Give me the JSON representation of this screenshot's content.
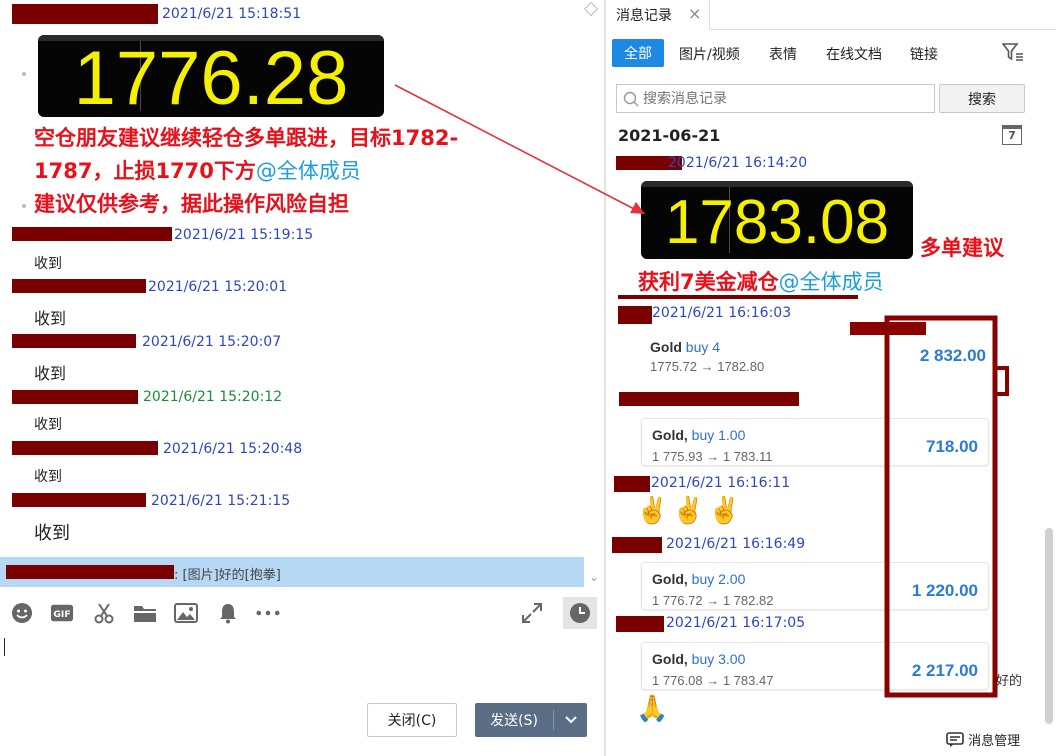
{
  "left_chat": {
    "first_time": "2021/6/21 15:18:51",
    "big_price": "1776.28",
    "advice_line1": "空仓朋友建议继续轻仓多单跟进，目标1782-",
    "advice_line2_prefix": "1787，止损1770下方",
    "advice_at": "@全体成员",
    "advice_line3": "建议仅供参考，据此操作风险自担",
    "replies": [
      {
        "time": "2021/6/21 15:19:15",
        "text": "收到"
      },
      {
        "time": "2021/6/21 15:20:01",
        "text": "收到"
      },
      {
        "time": "2021/6/21 15:20:07",
        "text": "收到"
      },
      {
        "time": "2021/6/21 15:20:12",
        "text": "收到"
      },
      {
        "time": "2021/6/21 15:20:48",
        "text": "收到"
      },
      {
        "time": "2021/6/21 15:21:15",
        "text": "收到"
      }
    ],
    "preview_text": ": [图片]好的[抱拳]",
    "close_label": "关闭(C)",
    "send_label": "发送(S)"
  },
  "history": {
    "tab_title": "消息记录",
    "close_icon": "×",
    "tabs": [
      "全部",
      "图片/视频",
      "表情",
      "在线文档",
      "链接"
    ],
    "search_placeholder": "搜索消息记录",
    "search_button": "搜索",
    "date_heading": "2021-06-21",
    "calendar_day": "7",
    "msg1_time": "2021/6/21 16:14:20",
    "big_price": "1783.08",
    "buy_advice": "多单建议",
    "profit_text": "获利7美金减仓",
    "profit_at": "@全体成员",
    "msg2_time": "2021/6/21 16:16:03",
    "msg3_time": "2021/6/21 16:16:11",
    "msg4_time": "2021/6/21 16:16:49",
    "msg5_time": "2021/6/21 16:17:05",
    "trades": [
      {
        "symbol": "Gold",
        "side": "buy 4",
        "path": "1775.72 → 1782.80",
        "profit": "2 832.00"
      },
      {
        "symbol": "Gold,",
        "side": "buy 1.00",
        "path": "1 775.93 → 1 783.11",
        "profit": "718.00"
      },
      {
        "symbol": "Gold,",
        "side": "buy 2.00",
        "path": "1 776.72 → 1 782.82",
        "profit": "1 220.00"
      },
      {
        "symbol": "Gold,",
        "side": "buy 3.00",
        "path": "1 776.08 → 1 783.47",
        "profit": "2 217.00"
      }
    ],
    "trailing_text": "好的",
    "manage_label": "消息管理"
  },
  "colors": {
    "accent": "#1e88e5",
    "price_text": "#f4f000",
    "red_text": "#e8101a",
    "redact": "#7a0000",
    "annot": "#8b0000"
  }
}
